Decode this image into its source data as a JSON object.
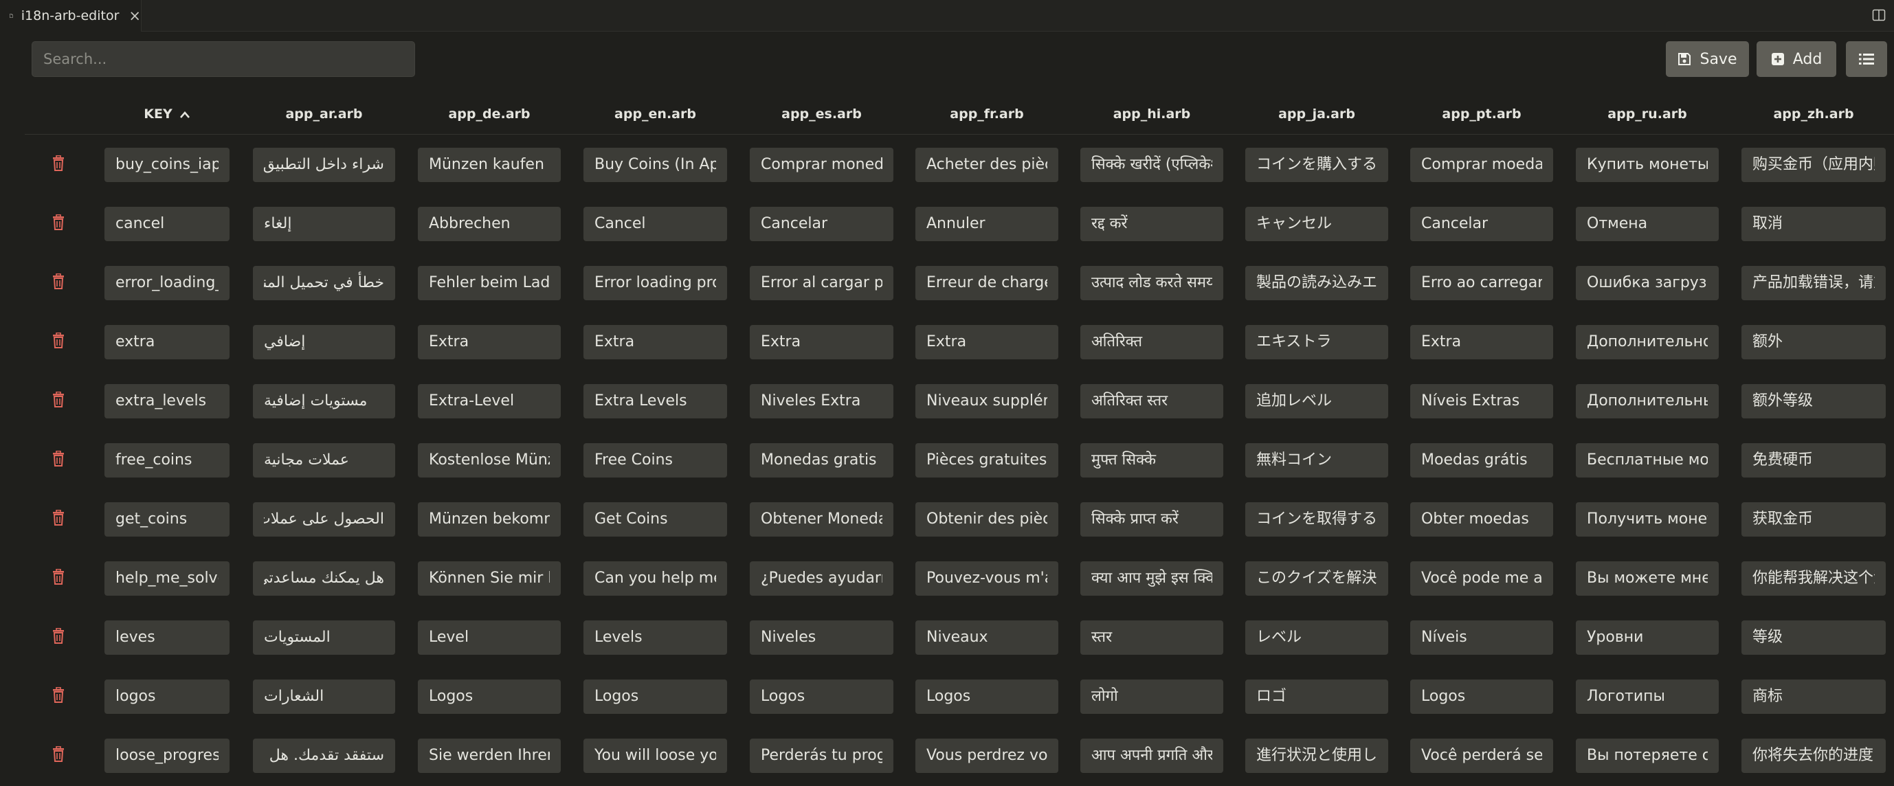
{
  "tab": {
    "title": "i18n-arb-editor",
    "close_glyph": "×",
    "icon": "file-icon"
  },
  "toolbar": {
    "search_placeholder": "Search...",
    "save_label": "Save",
    "add_label": "Add",
    "save_icon": "save-icon",
    "add_icon": "plus-square-icon",
    "list_icon": "list-icon"
  },
  "table": {
    "columns": [
      "KEY",
      "app_ar.arb",
      "app_de.arb",
      "app_en.arb",
      "app_es.arb",
      "app_fr.arb",
      "app_hi.arb",
      "app_ja.arb",
      "app_pt.arb",
      "app_ru.arb",
      "app_zh.arb"
    ],
    "sort": {
      "column": "KEY",
      "direction": "ascending"
    },
    "row_icon": "trash-icon",
    "colors": {
      "trash": "#e0665a"
    },
    "rows": [
      [
        "buy_coins_iap",
        "شراء داخل التطبيق)",
        "Münzen kaufen (In-App-Kauf)",
        "Buy Coins (In App Purchase)",
        "Comprar monedas (compra en la aplicación)",
        "Acheter des pièces (achat intégré)",
        "सिक्के खरीदें (एप्लिकेशन में खरीदारी)",
        "コインを購入する（アプリ内購入）",
        "Comprar moedas (compra no aplicativo)",
        "Купить монеты (покупка в приложении)",
        "购买金币（应用内购买）"
      ],
      [
        "cancel",
        "إلغاء",
        "Abbrechen",
        "Cancel",
        "Cancelar",
        "Annuler",
        "रद्द करें",
        "キャンセル",
        "Cancelar",
        "Отмена",
        "取消"
      ],
      [
        "error_loading_products",
        "خطأ في تحميل المنتجات، يرجى المحاولة مرة أخرى",
        "Fehler beim Laden der Produkte",
        "Error loading products",
        "Error al cargar productos",
        "Erreur de chargement des produits",
        "उत्पाद लोड करते समय त्रुटि",
        "製品の読み込みエラー",
        "Erro ao carregar produtos",
        "Ошибка загрузки продуктов",
        "产品加载错误，请重试"
      ],
      [
        "extra",
        "إضافي",
        "Extra",
        "Extra",
        "Extra",
        "Extra",
        "अतिरिक्त",
        "エキストラ",
        "Extra",
        "Дополнительно",
        "额外"
      ],
      [
        "extra_levels",
        "مستويات إضافية",
        "Extra-Level",
        "Extra Levels",
        "Niveles Extra",
        "Niveaux supplémentaires",
        "अतिरिक्त स्तर",
        "追加レベル",
        "Níveis Extras",
        "Дополнительные уровни",
        "额外等级"
      ],
      [
        "free_coins",
        "عملات مجانية",
        "Kostenlose Münzen",
        "Free Coins",
        "Monedas gratis",
        "Pièces gratuites",
        "मुफ्त सिक्के",
        "無料コイン",
        "Moedas grátis",
        "Бесплатные монеты",
        "免费硬币"
      ],
      [
        "get_coins",
        "الحصول على عملات",
        "Münzen bekommen",
        "Get Coins",
        "Obtener Monedas",
        "Obtenir des pièces",
        "सिक्के प्राप्त करें",
        "コインを取得する",
        "Obter moedas",
        "Получить монеты",
        "获取金币"
      ],
      [
        "help_me_solve",
        "هل يمكنك مساعدتي في حل هذا الاختبار؟",
        "Können Sie mir bei diesem Quiz helfen?",
        "Can you help me solve this quiz?",
        "¿Puedes ayudarme a resolver este cuestionario?",
        "Pouvez-vous m'aider à résoudre ce quiz ?",
        "क्या आप मुझे इस क्विज़ को हल करने में मदद कर सकते हैं?",
        "このクイズを解決するのを手伝ってくれますか？",
        "Você pode me ajudar a resolver este quiz?",
        "Вы можете мне помочь решить эту викторину?",
        "你能帮我解决这个测验吗？"
      ],
      [
        "leves",
        "المستويات",
        "Level",
        "Levels",
        "Niveles",
        "Niveaux",
        "स्तर",
        "レベル",
        "Níveis",
        "Уровни",
        "等级"
      ],
      [
        "logos",
        "الشعارات",
        "Logos",
        "Logos",
        "Logos",
        "Logos",
        "लोगो",
        "ロゴ",
        "Logos",
        "Логотипы",
        "商标"
      ],
      [
        "loose_progress",
        "ستفقد تقدمك. هل أنت متأكد أنك تريد الخروج؟",
        "Sie werden Ihren Fortschritt verlieren",
        "You will loose your progress",
        "Perderás tu progreso",
        "Vous perdrez votre progression",
        "आप अपनी प्रगति और सिक्के खो देंगे",
        "進行状況と使用したコインを失います",
        "Você perderá seu progresso",
        "Вы потеряете свой прогресс",
        "你将失去你的进度"
      ]
    ]
  }
}
